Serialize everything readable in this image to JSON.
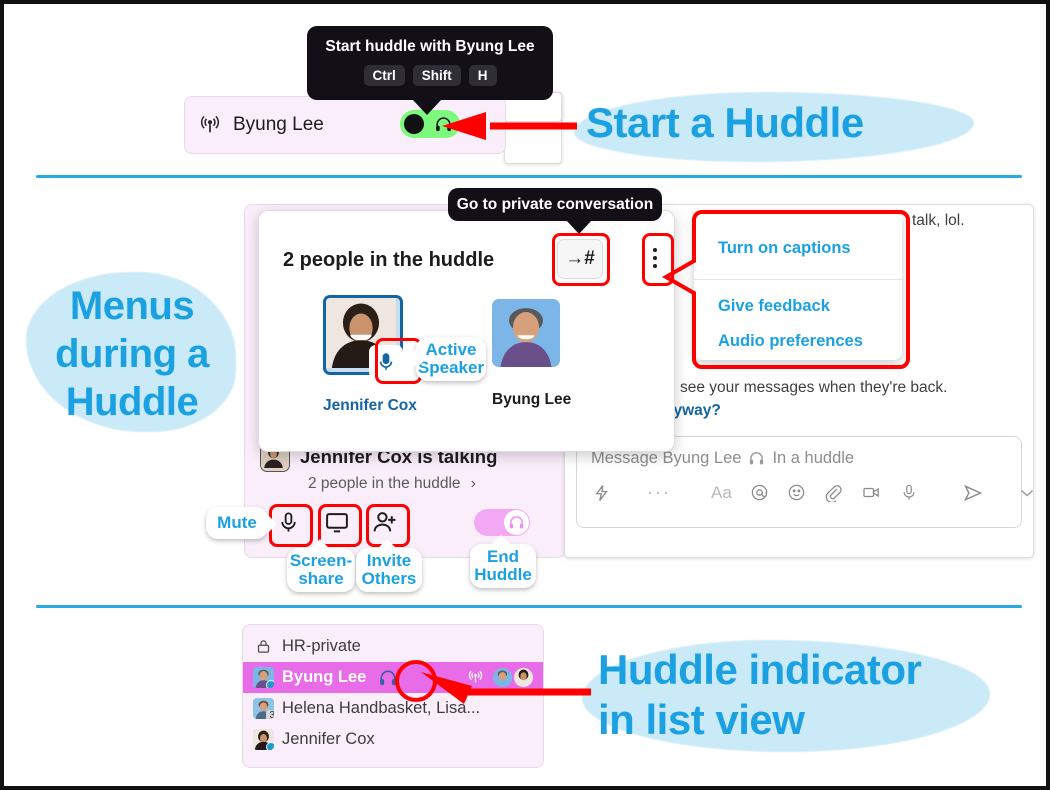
{
  "sections": {
    "start_huddle": {
      "annotation": "Start a Huddle",
      "tooltip": {
        "title": "Start huddle with Byung Lee",
        "keys": [
          "Ctrl",
          "Shift",
          "H"
        ]
      },
      "header_row": {
        "name": "Byung Lee",
        "status_icon": "broadcast-icon",
        "toggle_icon": "headphones-icon"
      }
    },
    "menus_during_huddle": {
      "annotation_lines": [
        "Menus",
        "during a",
        "Huddle"
      ],
      "tooltip_private": "Go to private conversation",
      "popover": {
        "title": "2 people in the huddle",
        "channel_button_label": "→#",
        "kebab_label": "⋮",
        "participants": [
          {
            "name": "Jennifer Cox",
            "active_speaker": true,
            "badge": "Active Speaker"
          },
          {
            "name": "Byung Lee",
            "active_speaker": false,
            "badge": ""
          }
        ]
      },
      "kebab_menu": {
        "items": [
          "Turn on captions",
          "Give feedback",
          "Audio preferences"
        ]
      },
      "status_bar": {
        "talking_text": "Jennifer Cox is talking",
        "subtext": "2 people in the huddle",
        "chevron": "›"
      },
      "controls": [
        {
          "icon": "microphone-icon",
          "callout": "Mute"
        },
        {
          "icon": "screen-share-icon",
          "callout": "Screen-\nshare"
        },
        {
          "icon": "invite-person-icon",
          "callout": "Invite\nOthers"
        },
        {
          "icon": "headphones-icon",
          "callout": "End\nHuddle"
        }
      ],
      "callouts": {
        "mute": "Mute",
        "screenshare": [
          "Screen-",
          "share"
        ],
        "invite": [
          "Invite",
          "Others"
        ],
        "end": [
          "End",
          "Huddle"
        ]
      },
      "chat": {
        "line_top": "talk, lol.",
        "line_a": "see your messages when they're back.",
        "line_b": "nyway?",
        "composer_placeholder": "Message Byung Lee",
        "composer_status": "In a huddle",
        "composer_status_icon": "headphones-icon",
        "composer_icons": [
          "lightning-icon",
          "more-icon",
          "format-icon",
          "mention-icon",
          "emoji-icon",
          "attachment-icon",
          "video-icon",
          "microphone-icon",
          "send-icon",
          "chevron-down-icon"
        ],
        "format_label": "Aa"
      }
    },
    "list_view": {
      "annotation_lines": [
        "Huddle indicator",
        "in list view"
      ],
      "rows": [
        {
          "icon": "lock-icon",
          "label": "HR-private",
          "active": false,
          "huddle": false
        },
        {
          "icon": "avatar",
          "label": "Byung Lee",
          "active": true,
          "huddle": true,
          "huddle_icon": "headphones-icon",
          "trailing_icon": "broadcast-icon",
          "trailing_avatars": 2
        },
        {
          "icon": "avatar",
          "label": "Helena Handbasket, Lisa...",
          "active": false,
          "huddle": false,
          "count_badge": "3"
        },
        {
          "icon": "avatar",
          "label": "Jennifer Cox",
          "active": false,
          "huddle": false
        }
      ]
    }
  },
  "colors": {
    "accent_blue": "#1ba1e2",
    "highlight_blob": "#cbeaf7",
    "arrow_red": "#ff0000",
    "active_row": "#e86ce8",
    "panel_pink": "#fbeefb",
    "toggle_green": "#7cf97c",
    "toggle_pink": "#f3a8f3",
    "divider": "#29abe2"
  }
}
